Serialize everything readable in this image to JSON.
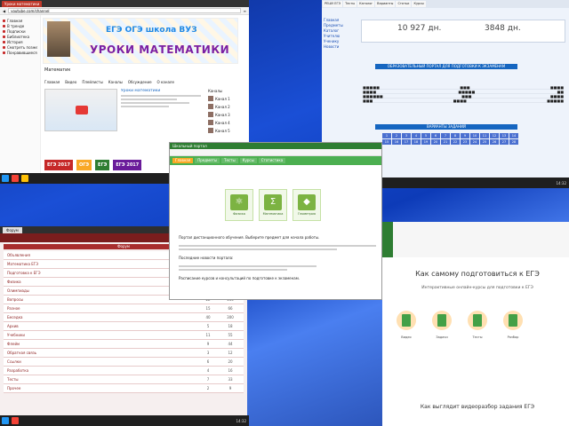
{
  "yt": {
    "tab_title": "Уроки математики",
    "url": "youtube.com/channel",
    "sidebar": [
      "Главная",
      "В тренде",
      "Подписки",
      "Библиотека",
      "История",
      "Смотреть позже",
      "Понравившиеся"
    ],
    "banner_top": "ЕГЭ ОГЭ школа ВУЗ",
    "banner_main": "УРОКИ МАТЕМАТИКИ",
    "channel_name": "Математик",
    "tabs": [
      "Главная",
      "Видео",
      "Плейлисты",
      "Каналы",
      "Обсуждение",
      "О канале"
    ],
    "video_title": "Уроки математики",
    "subs_title": "Каналы",
    "subs": [
      "Канал 1",
      "Канал 2",
      "Канал 3",
      "Канал 4",
      "Канал 5"
    ],
    "promo": [
      "ЕГЭ 2017",
      "ОГЭ",
      "ЕГЭ",
      "ЕГЭ 2017"
    ]
  },
  "ege": {
    "tabs": [
      "РЕШУ ЕГЭ",
      "Тесты",
      "Каталог",
      "Варианты",
      "Статьи",
      "Курсы"
    ],
    "left": [
      "Главная",
      "Предметы",
      "Каталог",
      "Учителю",
      "Ученику",
      "Новости"
    ],
    "score1": "10 927 дн.",
    "score2": "3848 дн.",
    "bar1": "ОБРАЗОВАТЕЛЬНЫЙ ПОРТАЛ ДЛЯ ПОДГОТОВКИ К ЭКЗАМЕНАМ",
    "bar2": "ВАРИАНТЫ ЗАДАНИЙ",
    "grid": [
      "1",
      "2",
      "3",
      "4",
      "5",
      "6",
      "7",
      "8",
      "9",
      "10",
      "11",
      "12",
      "13",
      "14",
      "15",
      "16",
      "17",
      "18",
      "19",
      "20",
      "21",
      "22",
      "23",
      "24",
      "25",
      "26",
      "27",
      "28"
    ]
  },
  "forum": {
    "tab": "Форум",
    "header": "Форум",
    "rows": [
      {
        "name": "Объявления",
        "topics": "12",
        "posts": "48"
      },
      {
        "name": "Математика ЕГЭ",
        "topics": "35",
        "posts": "210"
      },
      {
        "name": "Подготовка к ЕГЭ",
        "topics": "28",
        "posts": "143"
      },
      {
        "name": "Физика",
        "topics": "19",
        "posts": "97"
      },
      {
        "name": "Олимпиады",
        "topics": "8",
        "posts": "41"
      },
      {
        "name": "Вопросы",
        "topics": "22",
        "posts": "130"
      },
      {
        "name": "Разное",
        "topics": "15",
        "posts": "66"
      },
      {
        "name": "Беседка",
        "topics": "40",
        "posts": "300"
      },
      {
        "name": "Архив",
        "topics": "5",
        "posts": "18"
      },
      {
        "name": "Учебники",
        "topics": "11",
        "posts": "55"
      },
      {
        "name": "Флейм",
        "topics": "9",
        "posts": "44"
      },
      {
        "name": "Обратная связь",
        "topics": "3",
        "posts": "12"
      },
      {
        "name": "Ссылки",
        "topics": "6",
        "posts": "20"
      },
      {
        "name": "Разработка",
        "topics": "4",
        "posts": "16"
      },
      {
        "name": "Тесты",
        "topics": "7",
        "posts": "33"
      },
      {
        "name": "Прочее",
        "topics": "2",
        "posts": "9"
      }
    ]
  },
  "portal": {
    "title": "Школьный портал",
    "nav": [
      "Главная",
      "Предметы",
      "Тесты",
      "Курсы",
      "Статистика"
    ],
    "tiles": [
      {
        "icon": "⚛",
        "label": "Физика"
      },
      {
        "icon": "Σ",
        "label": "Математика"
      },
      {
        "icon": "◆",
        "label": "Геометрия"
      }
    ],
    "text1": "Портал дистанционного обучения. Выберите предмет для начала работы.",
    "text2": "Последние новости портала:",
    "text3": "Расписание курсов и консультаций по подготовке к экзаменам."
  },
  "land": {
    "title": "Как самому подготовиться к ЕГЭ",
    "subtitle": "Интерактивные онлайн-курсы для подготовки к ЕГЭ",
    "labels": [
      "Видео",
      "Задачи",
      "Тесты",
      "Разбор"
    ],
    "bottom": "Как выглядит видеоразбор задания ЕГЭ"
  },
  "taskbars": {
    "time1": "14:32",
    "time2": "14:32",
    "time3": "14:32"
  }
}
